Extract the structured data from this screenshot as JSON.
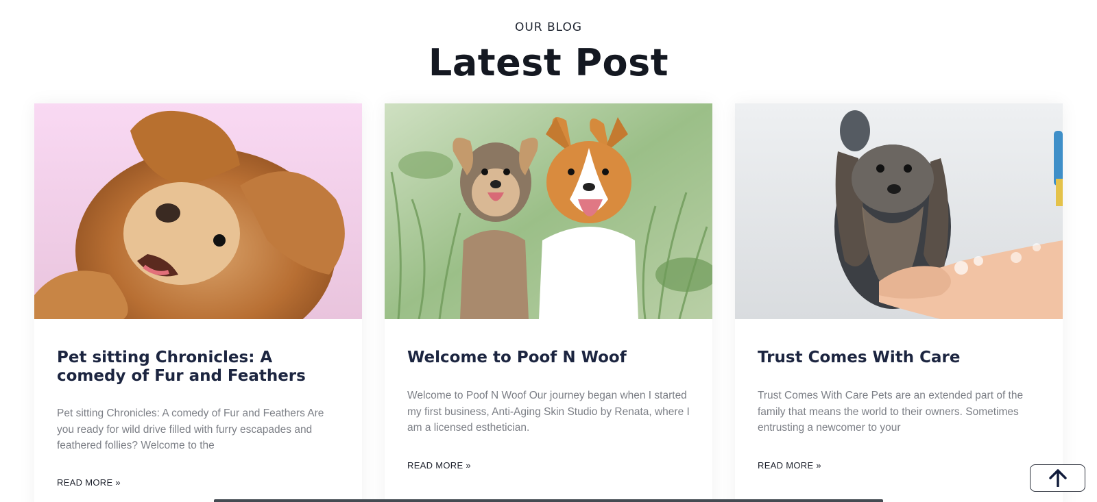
{
  "section": {
    "eyebrow": "OUR BLOG",
    "heading": "Latest Post"
  },
  "posts": [
    {
      "title": "Pet sitting Chronicles: A comedy of Fur and Feathers",
      "excerpt": "Pet sitting Chronicles: A comedy of Fur and Feathers Are you ready for wild drive filled with furry escapades and feathered follies? Welcome to the",
      "read_more": "READ MORE »"
    },
    {
      "title": "Welcome to Poof N Woof",
      "excerpt": "Welcome to Poof N Woof Our journey began when I started my first business, Anti-Aging Skin Studio by Renata, where I am a licensed esthetician.",
      "read_more": "READ MORE »"
    },
    {
      "title": "Trust Comes With Care",
      "excerpt": "Trust Comes With Care Pets are an extended part of the family that means the world to their owners. Sometimes entrusting a newcomer to your",
      "read_more": "READ MORE »"
    }
  ],
  "scroll_top_icon": "arrow-up-icon",
  "colors": {
    "heading": "#141821",
    "post_title": "#1c2540",
    "excerpt": "#7c7f86",
    "card_shadow": "rgba(0,0,0,0.06)"
  }
}
